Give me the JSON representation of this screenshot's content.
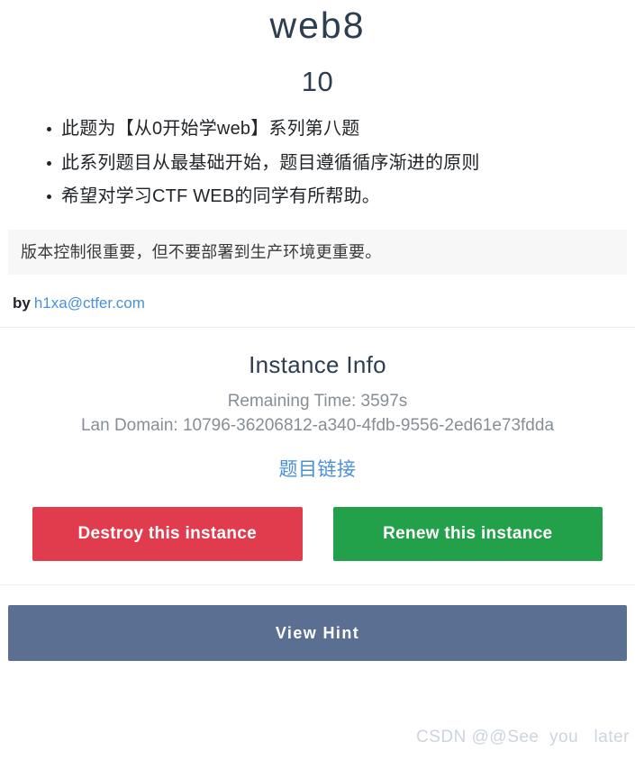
{
  "challenge": {
    "title": "web8",
    "score": "10",
    "description_bullets": [
      "此题为【从0开始学web】系列第八题",
      "此系列题目从最基础开始，题目遵循循序渐进的原则",
      "希望对学习CTF WEB的同学有所帮助。"
    ],
    "alert_text": "版本控制很重要，但不要部署到生产环境更重要。",
    "author_prefix": "by",
    "author_email": "h1xa@ctfer.com"
  },
  "instance": {
    "heading": "Instance Info",
    "remaining_time": "Remaining Time: 3597s",
    "lan_domain": "Lan Domain: 10796-36206812-a340-4fdb-9556-2ed61e73fdda",
    "challenge_link_label": "题目链接",
    "destroy_label": "Destroy this instance",
    "renew_label": "Renew this instance"
  },
  "hint": {
    "view_hint_label": "View Hint"
  },
  "watermark": {
    "text": "CSDN @@See  you   later"
  },
  "colors": {
    "title": "#2c3e50",
    "link": "#4a90d9",
    "muted": "#868e96",
    "alert_bg": "#f7f7f7",
    "destroy_bg": "#e03c4e",
    "renew_bg": "#22a04a",
    "hint_bg": "#5a6f91",
    "rule": "#e9ebed",
    "watermark": "#cdd4de"
  }
}
